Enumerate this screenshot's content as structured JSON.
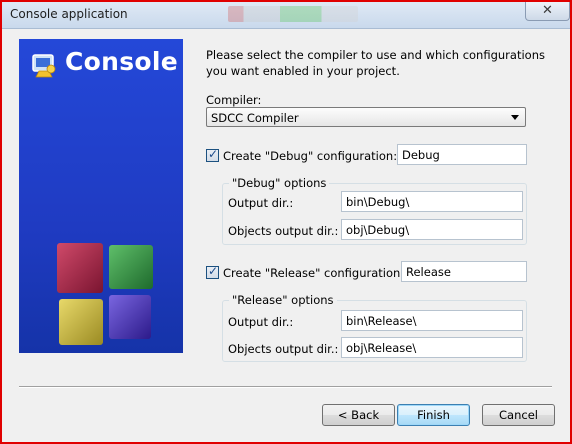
{
  "window": {
    "title": "Console application",
    "close_glyph": "✕"
  },
  "banner": {
    "title": "Console",
    "logo_icon": "codeblocks-logo-icon",
    "art_icon": "color-cubes-icon"
  },
  "intro": "Please select the compiler to use and which configurations you want enabled in your project.",
  "compiler": {
    "label": "Compiler:",
    "value": "SDCC Compiler"
  },
  "debug": {
    "checked": true,
    "checkbox_label": "Create \"Debug\" configuration:",
    "name": "Debug",
    "group_label": "\"Debug\" options",
    "output_label": "Output dir.:",
    "output_value": "bin\\Debug\\",
    "objects_label": "Objects output dir.:",
    "objects_value": "obj\\Debug\\"
  },
  "release": {
    "checked": true,
    "checkbox_label": "Create \"Release\" configuration:",
    "name": "Release",
    "group_label": "\"Release\" options",
    "output_label": "Output dir.:",
    "output_value": "bin\\Release\\",
    "objects_label": "Objects output dir.:",
    "objects_value": "obj\\Release\\"
  },
  "buttons": {
    "back": "< Back",
    "finish": "Finish",
    "cancel": "Cancel"
  },
  "colors": {
    "banner": "#2448d8",
    "highlight_border": "#e00000",
    "default_button": "#3c7fb1"
  }
}
